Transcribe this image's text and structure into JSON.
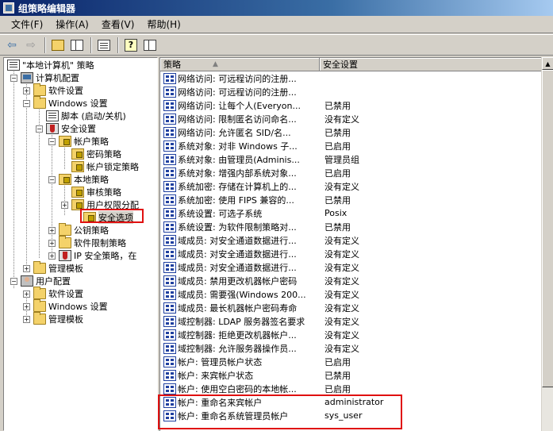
{
  "window": {
    "title": "组策略编辑器"
  },
  "menu": [
    {
      "label": "文件(F)"
    },
    {
      "label": "操作(A)"
    },
    {
      "label": "查看(V)"
    },
    {
      "label": "帮助(H)"
    }
  ],
  "toolbar": {
    "back_icon": "back-arrow-icon",
    "forward_icon": "forward-arrow-icon",
    "up_icon": "up-folder-icon",
    "show_hide_tree_icon": "show-hide-tree-icon",
    "export_icon": "export-list-icon",
    "help_icon": "help-icon",
    "properties_icon": "properties-icon"
  },
  "tree": {
    "root": "\"本地计算机\" 策略",
    "computer_config": "计算机配置",
    "software_settings": "软件设置",
    "windows_settings": "Windows 设置",
    "scripts": "脚本 (启动/关机)",
    "security_settings": "安全设置",
    "account_policies": "帐户策略",
    "password_policy": "密码策略",
    "lockout_policy": "帐户锁定策略",
    "local_policies": "本地策略",
    "audit_policy": "审核策略",
    "user_rights": "用户权限分配",
    "security_options": "安全选项",
    "public_key": "公钥策略",
    "software_restriction": "软件限制策略",
    "ipsec": "IP 安全策略，在",
    "admin_templates": "管理模板",
    "user_config": "用户配置",
    "user_software_settings": "软件设置",
    "user_windows_settings": "Windows 设置",
    "user_admin_templates": "管理模板"
  },
  "list": {
    "headers": {
      "policy": "策略",
      "setting": "安全设置"
    },
    "rows": [
      {
        "policy": "网络访问: 可远程访问的注册...",
        "setting": ""
      },
      {
        "policy": "网络访问: 可远程访问的注册...",
        "setting": ""
      },
      {
        "policy": "网络访问: 让每个人(Everyon...",
        "setting": "已禁用"
      },
      {
        "policy": "网络访问: 限制匿名访问命名...",
        "setting": "没有定义"
      },
      {
        "policy": "网络访问: 允许匿名 SID/名...",
        "setting": "已禁用"
      },
      {
        "policy": "系统对象: 对非 Windows 子...",
        "setting": "已启用"
      },
      {
        "policy": "系统对象: 由管理员(Adminis...",
        "setting": "管理员组"
      },
      {
        "policy": "系统对象: 增强内部系统对象...",
        "setting": "已启用"
      },
      {
        "policy": "系统加密: 存储在计算机上的...",
        "setting": "没有定义"
      },
      {
        "policy": "系统加密: 使用 FIPS 兼容的...",
        "setting": "已禁用"
      },
      {
        "policy": "系统设置: 可选子系统",
        "setting": "Posix"
      },
      {
        "policy": "系统设置: 为软件限制策略对...",
        "setting": "已禁用"
      },
      {
        "policy": "域成员: 对安全通道数据进行...",
        "setting": "没有定义"
      },
      {
        "policy": "域成员: 对安全通道数据进行...",
        "setting": "没有定义"
      },
      {
        "policy": "域成员: 对安全通道数据进行...",
        "setting": "没有定义"
      },
      {
        "policy": "域成员: 禁用更改机器帐户密码",
        "setting": "没有定义"
      },
      {
        "policy": "域成员: 需要强(Windows 200...",
        "setting": "没有定义"
      },
      {
        "policy": "域成员: 最长机器帐户密码寿命",
        "setting": "没有定义"
      },
      {
        "policy": "域控制器: LDAP 服务器签名要求",
        "setting": "没有定义"
      },
      {
        "policy": "域控制器: 拒绝更改机器帐户...",
        "setting": "没有定义"
      },
      {
        "policy": "域控制器: 允许服务器操作员...",
        "setting": "没有定义"
      },
      {
        "policy": "帐户: 管理员帐户状态",
        "setting": "已启用"
      },
      {
        "policy": "帐户: 来宾帐户状态",
        "setting": "已禁用"
      },
      {
        "policy": "帐户: 使用空白密码的本地帐...",
        "setting": "已启用"
      },
      {
        "policy": "帐户: 重命名来宾帐户",
        "setting": "administrator"
      },
      {
        "policy": "帐户: 重命名系统管理员帐户",
        "setting": "sys_user"
      }
    ]
  },
  "colors": {
    "title_bar": "#0a246a",
    "highlight": "#e01010",
    "window_bg": "#d4d0c8"
  }
}
